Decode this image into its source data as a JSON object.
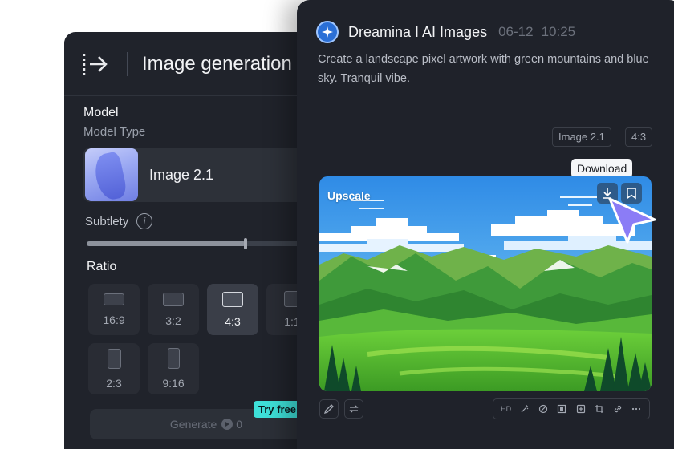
{
  "generator_panel": {
    "title": "Image generation",
    "model_section_title": "Model",
    "model_type_label": "Model Type",
    "model_name": "Image 2.1",
    "subtlety_label": "Subtlety",
    "subtlety_value": 0.66,
    "ratio_title": "Ratio",
    "ratios": [
      {
        "label": "16:9",
        "selected": false
      },
      {
        "label": "3:2",
        "selected": false
      },
      {
        "label": "4:3",
        "selected": true
      },
      {
        "label": "1:1",
        "selected": false
      },
      {
        "label": "2:3",
        "selected": false
      },
      {
        "label": "9:16",
        "selected": false
      }
    ],
    "generate_label": "Generate",
    "generate_cost": "0",
    "try_free_badge": "Try free"
  },
  "result_panel": {
    "app_name": "Dreamina I AI Images",
    "date": "06-12",
    "time": "10:25",
    "prompt": "Create a landscape pixel artwork with green mountains and blue sky. Tranquil vibe.",
    "tags": [
      "Image 2.1",
      "4:3"
    ],
    "upscale_label": "Upscale",
    "download_tooltip": "Download",
    "hd_label": "HD"
  },
  "icons": {
    "collapse": "collapse-sidebar-icon",
    "info": "info-icon",
    "app_logo": "dreamina-logo",
    "download": "download-icon",
    "bookmark": "bookmark-icon",
    "cursor": "pointer-cursor-icon",
    "edit": "edit-icon",
    "regenerate": "regenerate-icon",
    "tools": [
      "magic-wand-icon",
      "eraser-icon",
      "expand-icon",
      "inpaint-icon",
      "crop-icon",
      "link-icon",
      "more-icon"
    ]
  },
  "colors": {
    "panel_bg": "#20232b",
    "accent_teal": "#3ee0d8",
    "cursor_purple": "#8b7cf6"
  }
}
